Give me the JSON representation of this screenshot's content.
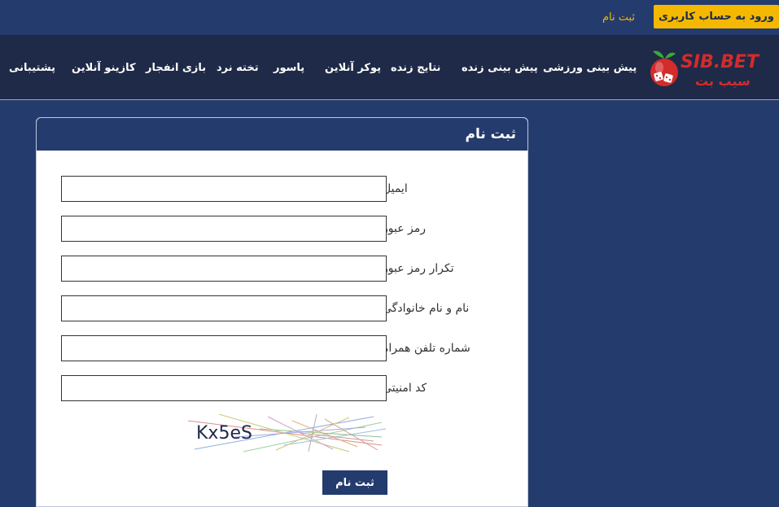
{
  "topbar": {
    "login_label": "ورود به حساب کاربری",
    "register_label": "ثبت نام"
  },
  "navbar": {
    "logo_text": "SIB.BET",
    "logo_subtext": "سیب بت",
    "items": [
      {
        "label": "پیش بینی ورزشی"
      },
      {
        "label": "پیش بینی زنده"
      },
      {
        "label": "نتایج زنده"
      },
      {
        "label": "پوکر آنلاین"
      },
      {
        "label": "پاسور"
      },
      {
        "label": "تخته نرد"
      },
      {
        "label": "بازی انفجار"
      },
      {
        "label": "کازینو آنلاین"
      },
      {
        "label": "پشتیبانی"
      }
    ]
  },
  "form": {
    "title": "ثبت نام",
    "fields": [
      {
        "label": "ایمیل",
        "value": ""
      },
      {
        "label": "رمز عبور",
        "value": ""
      },
      {
        "label": "تکرار رمز عبور",
        "value": ""
      },
      {
        "label": "نام و نام خانوادگی",
        "value": ""
      },
      {
        "label": "شماره تلفن همراه",
        "value": ""
      },
      {
        "label": "کد امنیتی",
        "value": ""
      }
    ],
    "captcha_text": "Kx5eS",
    "submit_label": "ثبت نام"
  },
  "colors": {
    "page_bg": "#243b6e",
    "navbar_bg": "#1e2a47",
    "accent": "#f5b800",
    "logo_red": "#d42b2b",
    "logo_green": "#3aa935"
  }
}
